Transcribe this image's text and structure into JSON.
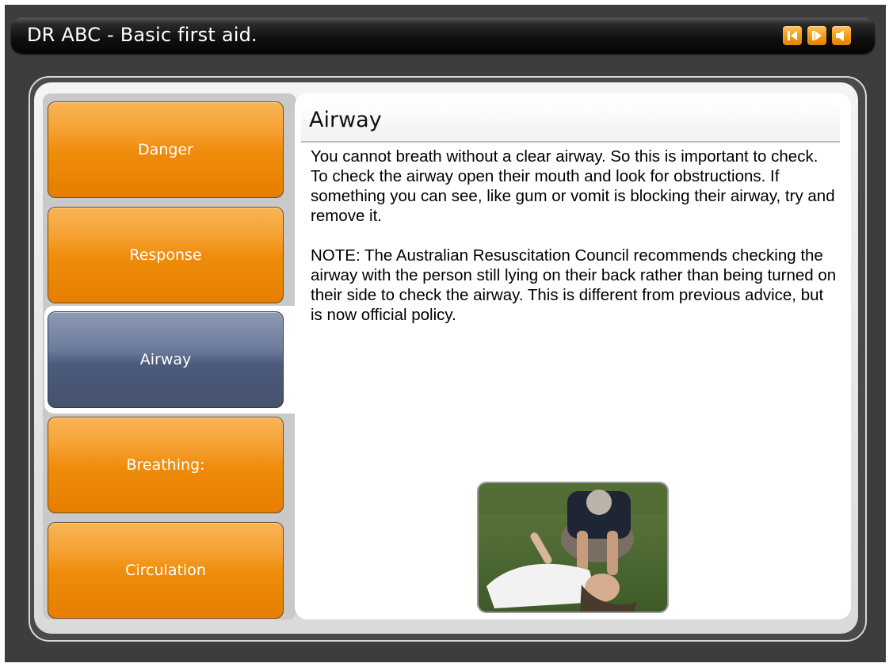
{
  "app": {
    "title": "DR ABC - Basic first aid.",
    "controls": [
      {
        "name": "previous",
        "icon": "previous-icon"
      },
      {
        "name": "next",
        "icon": "next-icon"
      },
      {
        "name": "audio",
        "icon": "speaker-icon"
      }
    ]
  },
  "nav": {
    "items": [
      {
        "label": "Danger",
        "active": false
      },
      {
        "label": "Response",
        "active": false
      },
      {
        "label": "Airway",
        "active": true
      },
      {
        "label": "Breathing:",
        "active": false
      },
      {
        "label": "Circulation",
        "active": false
      }
    ]
  },
  "content": {
    "heading": "Airway",
    "paragraphs": [
      "You cannot breath without a clear airway. So this is important to check. To check the airway open their mouth and look for obstructions. If something you can see, like gum or vomit is blocking their airway, try and remove it.",
      "NOTE: The Australian Resuscitation Council recommends checking the airway with the person still lying on their back rather than being turned on their side to check the airway. This is different from previous advice, but is now official policy."
    ]
  },
  "colors": {
    "accent_orange": "#ef8c0b",
    "active_blue": "#4c5a7c",
    "app_background": "#3d3d3d"
  }
}
